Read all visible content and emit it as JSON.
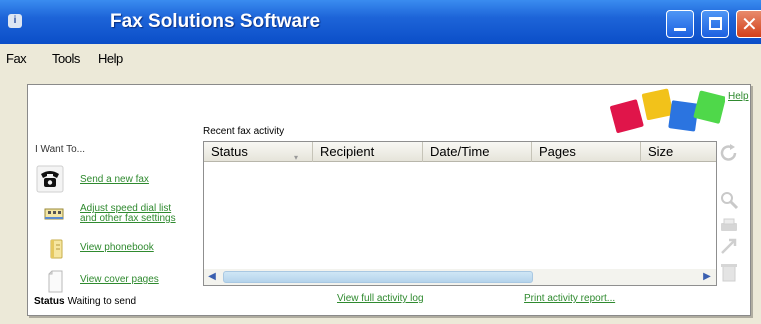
{
  "window": {
    "title": "Fax Solutions Software",
    "app_icon_glyph": "i"
  },
  "menu": {
    "items": [
      {
        "label": "Fax"
      },
      {
        "label": "Tools"
      },
      {
        "label": "Help"
      }
    ]
  },
  "panel": {
    "help_link": "Help",
    "want_to_label": "I Want To...",
    "tasks": [
      {
        "line1": "Send a new fax",
        "line2": "",
        "icon": "phone-icon"
      },
      {
        "line1": "Adjust speed dial list",
        "line2": "and other fax settings",
        "icon": "speed-dial-icon"
      },
      {
        "line1": "View phonebook",
        "line2": "",
        "icon": "phonebook-icon"
      },
      {
        "line1": "View cover pages",
        "line2": "",
        "icon": "cover-page-icon"
      }
    ],
    "status": {
      "label": "Status",
      "value": "Waiting to send"
    }
  },
  "activity": {
    "title": "Recent fax activity",
    "columns": [
      "Status",
      "Recipient",
      "Date/Time",
      "Pages",
      "Size"
    ],
    "rows": [],
    "view_full_log": "View full activity log",
    "print_report": "Print activity report..."
  },
  "colors": {
    "titlebar": "#1d64d8",
    "link_green": "#2f8a2f",
    "logo_red": "#e0154a",
    "logo_yellow": "#f2c21a",
    "logo_blue": "#2b74e0",
    "logo_green": "#4fd84a"
  }
}
